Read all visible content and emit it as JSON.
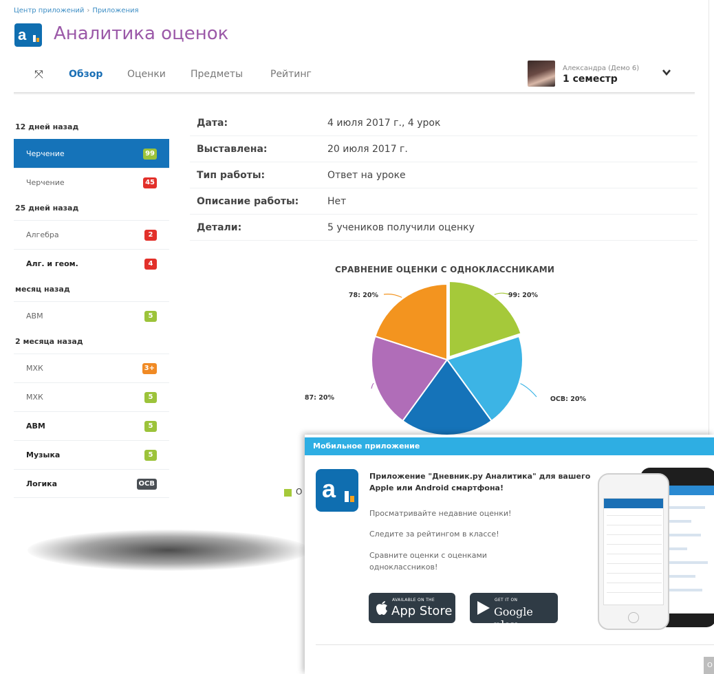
{
  "breadcrumb": {
    "root": "Центр приложений",
    "sep": "›",
    "current": "Приложения"
  },
  "app": {
    "title": "Аналитика оценок",
    "logo_letter": "a"
  },
  "tabs": [
    {
      "label": "Обзор",
      "active": true
    },
    {
      "label": "Оценки"
    },
    {
      "label": "Предметы"
    },
    {
      "label": "Рейтинг"
    }
  ],
  "user": {
    "name": "Александра (Демо 6)",
    "term": "1 семестр"
  },
  "sidebar": {
    "groups": [
      {
        "heading": "12 дней назад",
        "items": [
          {
            "subject": "Черчение",
            "grade": "99",
            "color": "#9cc33a",
            "active": true
          },
          {
            "subject": "Черчение",
            "grade": "45",
            "color": "#e2302a"
          }
        ]
      },
      {
        "heading": "25 дней назад",
        "items": [
          {
            "subject": "Алгебра",
            "grade": "2",
            "color": "#e2302a"
          },
          {
            "subject": "Алг. и геом.",
            "grade": "4",
            "color": "#e2302a",
            "bold": true
          }
        ]
      },
      {
        "heading": "месяц назад",
        "items": [
          {
            "subject": "АВМ",
            "grade": "5",
            "color": "#9cc33a"
          }
        ]
      },
      {
        "heading": "2 месяца назад",
        "items": [
          {
            "subject": "МХК",
            "grade": "3+",
            "color": "#f08a24"
          },
          {
            "subject": "МХК",
            "grade": "5",
            "color": "#9cc33a"
          },
          {
            "subject": "АВМ",
            "grade": "5",
            "color": "#9cc33a",
            "bold": true
          },
          {
            "subject": "Музыка",
            "grade": "5",
            "color": "#9cc33a",
            "bold": true
          },
          {
            "subject": "Логика",
            "grade": "ОСВ",
            "color": "#4a4f54",
            "bold": true
          }
        ]
      }
    ]
  },
  "details": [
    {
      "label": "Дата:",
      "value": "4 июля 2017 г., 4 урок"
    },
    {
      "label": "Выставлена:",
      "value": "20 июля 2017 г."
    },
    {
      "label": "Тип работы:",
      "value": "Ответ на уроке"
    },
    {
      "label": "Описание работы:",
      "value": "Нет"
    },
    {
      "label": "Детали:",
      "value": "5 учеников получили оценку"
    }
  ],
  "chart_data": {
    "type": "pie",
    "title": "СРАВНЕНИЕ ОЦЕНКИ С ОДНОКЛАССНИКАМИ",
    "slices": [
      {
        "label": "99: 20%",
        "value": 20,
        "color": "#a5c93a"
      },
      {
        "label": "ОСВ: 20%",
        "value": 20,
        "color": "#3cb4e5"
      },
      {
        "label": "",
        "value": 20,
        "color": "#1573b9"
      },
      {
        "label": "87: 20%",
        "value": 20,
        "color": "#b06db8"
      },
      {
        "label": "78: 20%",
        "value": 20,
        "color": "#f3941f"
      }
    ],
    "legend": [
      {
        "label": "О",
        "color": "#a5c93a"
      }
    ]
  },
  "mobile": {
    "header": "Мобильное приложение",
    "description": "Приложение \"Дневник.ру Аналитика\" для вашего Apple или Android смартфона!",
    "features": [
      "Просматривайте недавние оценки!",
      "Следите за рейтингом в классе!",
      "Сравните оценки с оценками одноклассников!"
    ],
    "appstore": {
      "small": "AVAILABLE ON THE",
      "big": "App Store"
    },
    "googleplay": {
      "small": "GET IT ON",
      "big": "Google play"
    },
    "corner": "О"
  }
}
